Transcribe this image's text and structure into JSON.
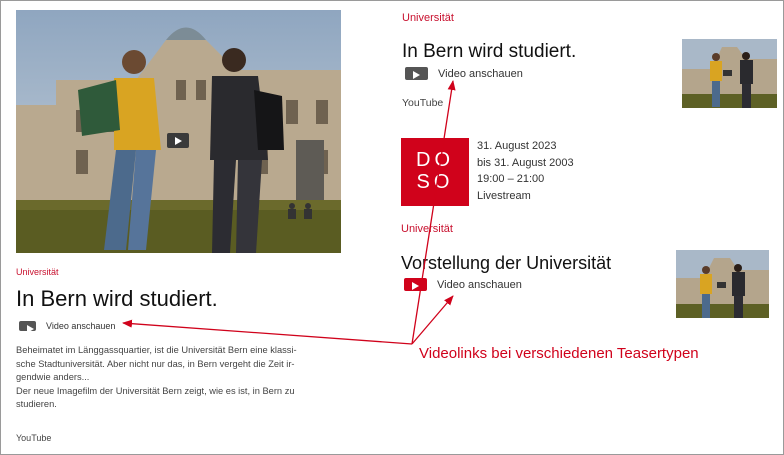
{
  "left_teaser": {
    "kicker": "Universität",
    "title": "In Bern wird studiert.",
    "video_label": "Video anschauen",
    "description_lines": [
      "Beheimatet im Länggassquartier, ist die Universität Bern eine klassi-",
      "sche Stadtuniversität. Aber nicht nur das, in Bern vergeht die Zeit ir-",
      "gendwie anders...",
      "Der neue Imagefilm der Universität Bern zeigt, wie es ist, in Bern zu",
      "studieren."
    ],
    "source": "YouTube"
  },
  "teaser_top_right": {
    "kicker": "Universität",
    "title": "In Bern wird studiert.",
    "video_label": "Video anschauen",
    "source": "YouTube"
  },
  "event_teaser": {
    "logo_line1": "DO",
    "logo_line2": "SO",
    "date_from": "31. August 2023",
    "date_to": "bis 31. August 2003",
    "time": "19:00  –  21:00",
    "location": "Livestream"
  },
  "teaser_bottom_right": {
    "kicker": "Universität",
    "title": "Vorstellung der Universität",
    "video_label": "Video anschauen"
  },
  "annotation": {
    "text": "Videolinks bei verschiedenen Teasertypen",
    "color": "#d0021b"
  },
  "colors": {
    "accent": "#c8102e",
    "play_red": "#d0021b"
  }
}
